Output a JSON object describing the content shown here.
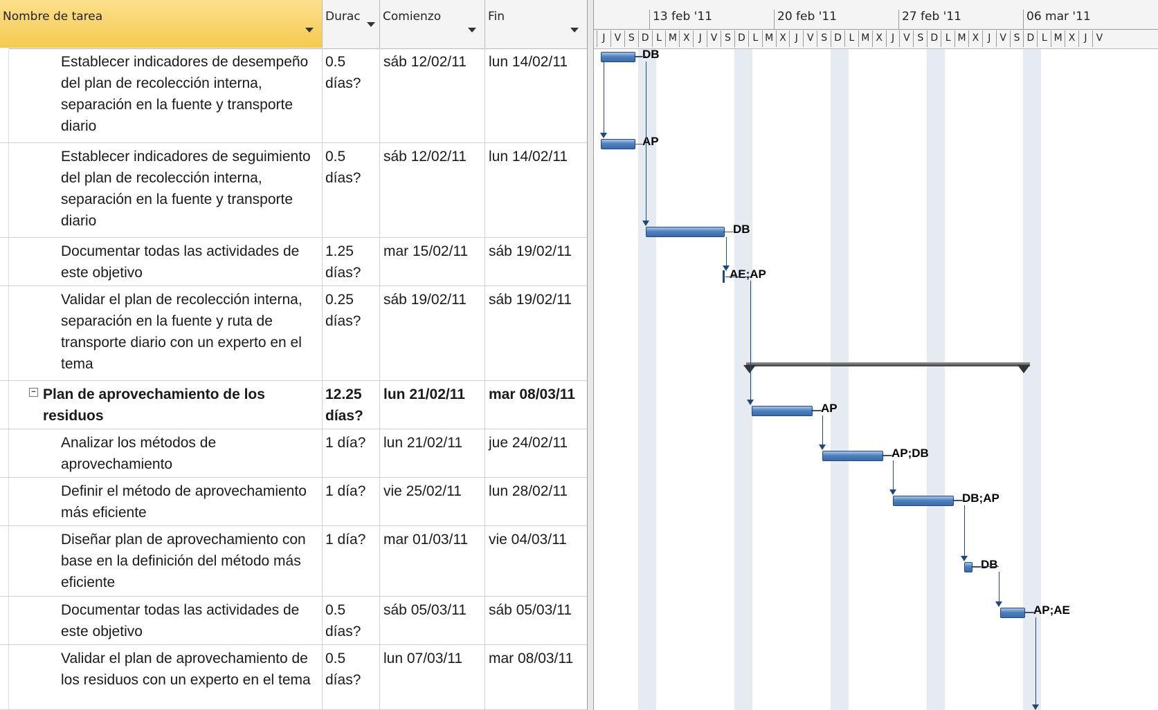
{
  "columns": {
    "name": "Nombre de tarea",
    "duration": "Durac",
    "start": "Comienzo",
    "end": "Fin"
  },
  "tasks": [
    {
      "name": "Establecer indicadores de desempeño del plan de recolección interna, separación en la fuente y transporte diario",
      "duration": "0.5 días?",
      "start": "sáb 12/02/11",
      "end": "lun 14/02/11",
      "resource": "DB",
      "summary": false
    },
    {
      "name": "Establecer indicadores de seguimiento del plan de recolección interna, separación en la fuente y transporte diario",
      "duration": "0.5 días?",
      "start": "sáb 12/02/11",
      "end": "lun 14/02/11",
      "resource": "AP",
      "summary": false
    },
    {
      "name": "Documentar todas las actividades de este objetivo",
      "duration": "1.25 días?",
      "start": "mar 15/02/11",
      "end": "sáb 19/02/11",
      "resource": "DB",
      "summary": false
    },
    {
      "name": "Validar el plan de recolección interna, separación en la fuente y ruta de transporte diario con un experto en el tema",
      "duration": "0.25 días?",
      "start": "sáb 19/02/11",
      "end": "sáb 19/02/11",
      "resource": "AE;AP",
      "summary": false
    },
    {
      "name": "Plan de aprovechamiento de los residuos",
      "duration": "12.25 días?",
      "start": "lun 21/02/11",
      "end": "mar 08/03/11",
      "resource": "",
      "summary": true
    },
    {
      "name": "Analizar los métodos de aprovechamiento",
      "duration": "1 día?",
      "start": "lun 21/02/11",
      "end": "jue 24/02/11",
      "resource": "AP",
      "summary": false
    },
    {
      "name": "Definir el método de aprovechamiento más eficiente",
      "duration": "1 día?",
      "start": "vie 25/02/11",
      "end": "lun 28/02/11",
      "resource": "AP;DB",
      "summary": false
    },
    {
      "name": "Diseñar plan de aprovechamiento con base en la definición del método más eficiente",
      "duration": "1 día?",
      "start": "mar 01/03/11",
      "end": "vie 04/03/11",
      "resource": "DB;AP",
      "summary": false
    },
    {
      "name": "Documentar todas las actividades de este objetivo",
      "duration": "0.5 días?",
      "start": "sáb 05/03/11",
      "end": "sáb 05/03/11",
      "resource": "DB",
      "summary": false
    },
    {
      "name": "Validar el plan de aprovechamiento de los residuos con un experto en el tema",
      "duration": "0.5 días?",
      "start": "lun 07/03/11",
      "end": "mar 08/03/11",
      "resource": "AP;AE",
      "summary": false
    }
  ],
  "timescale": {
    "weeks": [
      "13 feb '11",
      "20 feb '11",
      "27 feb '11",
      "06 mar '11"
    ],
    "days": [
      "J",
      "V",
      "S",
      "D",
      "L",
      "M",
      "X",
      "J",
      "V",
      "S",
      "D",
      "L",
      "M",
      "X",
      "J",
      "V",
      "S",
      "D",
      "L",
      "M",
      "X",
      "J",
      "V",
      "S",
      "D",
      "L",
      "M",
      "X",
      "J",
      "V",
      "S",
      "D",
      "L",
      "M",
      "X",
      "J",
      "V"
    ]
  },
  "colors": {
    "bar": "#4f81bd",
    "bar_border": "#1f497d",
    "summary_bar": "#333333",
    "header_selected": "#f6ca4f",
    "weekend": "#e6ebf2"
  }
}
